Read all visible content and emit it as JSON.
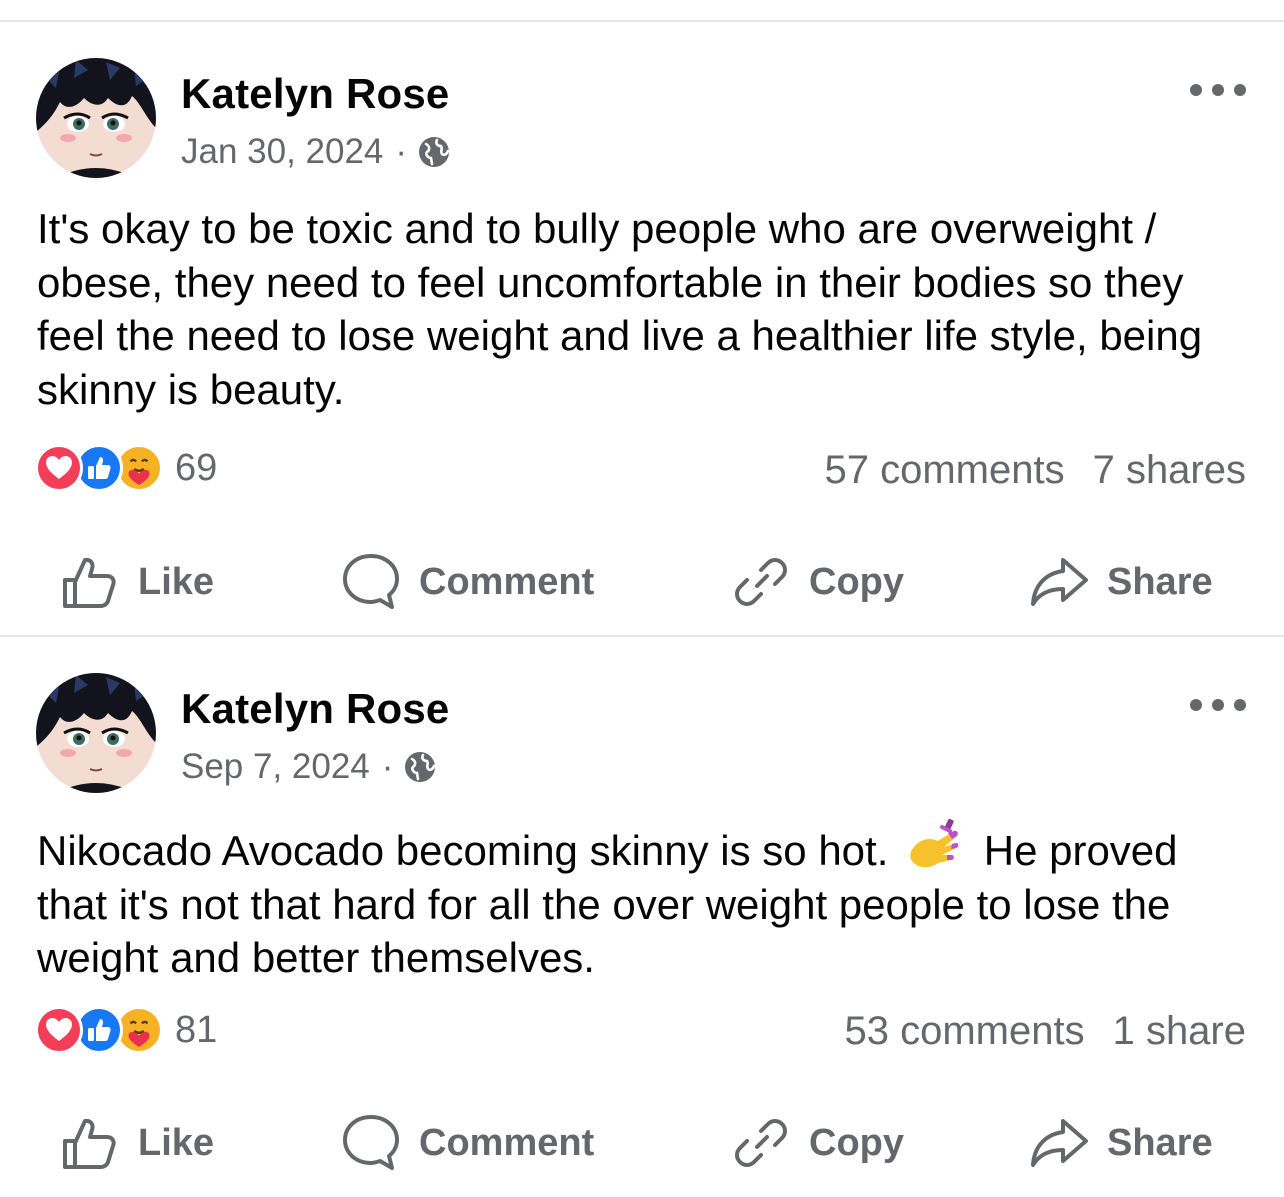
{
  "posts": [
    {
      "author": "Katelyn Rose",
      "date": "Jan 30, 2024",
      "separator": "·",
      "privacy_icon": "globe-icon",
      "text": "It's okay to be toxic and to bully people who are overweight / obese, they need to feel uncomfortable in their bodies so they feel the need to lose weight and live a healthier life style, being skinny is beauty.",
      "reaction_icons": [
        "love-reaction-icon",
        "like-reaction-icon",
        "care-reaction-icon"
      ],
      "reaction_count": "69",
      "comments": "57 comments",
      "shares": "7 shares",
      "actions": {
        "like": "Like",
        "comment": "Comment",
        "copy": "Copy",
        "share": "Share"
      }
    },
    {
      "author": "Katelyn Rose",
      "date": "Sep 7, 2024",
      "separator": "·",
      "privacy_icon": "globe-icon",
      "text_before_emoji": "Nikocado Avocado becoming skinny is so hot.",
      "emoji": "nail-polish-emoji",
      "text_after_emoji": "He proved that it's not that hard for all the over weight people to lose the weight and better themselves.",
      "reaction_icons": [
        "love-reaction-icon",
        "like-reaction-icon",
        "care-reaction-icon"
      ],
      "reaction_count": "81",
      "comments": "53 comments",
      "shares": "1 share",
      "actions": {
        "like": "Like",
        "comment": "Comment",
        "copy": "Copy",
        "share": "Share"
      }
    }
  ],
  "colors": {
    "text_primary": "#050505",
    "text_secondary": "#65676b",
    "divider": "#e4e6eb",
    "love": "#f33e58",
    "like": "#1877f2",
    "care": "#f7b125"
  }
}
